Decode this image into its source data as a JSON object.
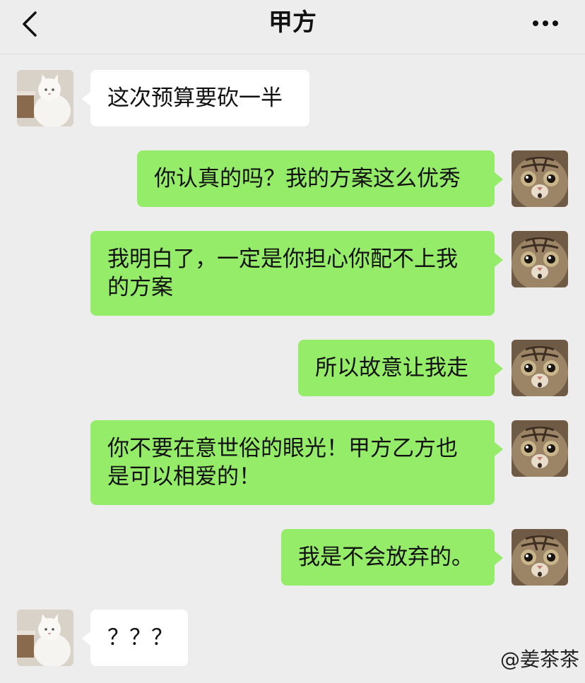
{
  "header": {
    "title": "甲方",
    "back_icon": "chevron-left-icon",
    "more_icon": "more-dots-icon"
  },
  "avatars": {
    "other": "white-cat-avatar",
    "me": "tabby-cat-avatar"
  },
  "colors": {
    "background": "#ededed",
    "incoming_bubble": "#ffffff",
    "outgoing_bubble": "#95ec69"
  },
  "messages": [
    {
      "sender": "other",
      "text": "这次预算要砍一半"
    },
    {
      "sender": "me",
      "text": "你认真的吗？我的方案这么优秀"
    },
    {
      "sender": "me",
      "text": "我明白了，一定是你担心你配不上我的方案"
    },
    {
      "sender": "me",
      "text": "所以故意让我走"
    },
    {
      "sender": "me",
      "text": "你不要在意世俗的眼光！甲方乙方也是可以相爱的！"
    },
    {
      "sender": "me",
      "text": "我是不会放弃的。"
    },
    {
      "sender": "other",
      "text": "？？？"
    }
  ],
  "watermark": "@姜茶茶"
}
